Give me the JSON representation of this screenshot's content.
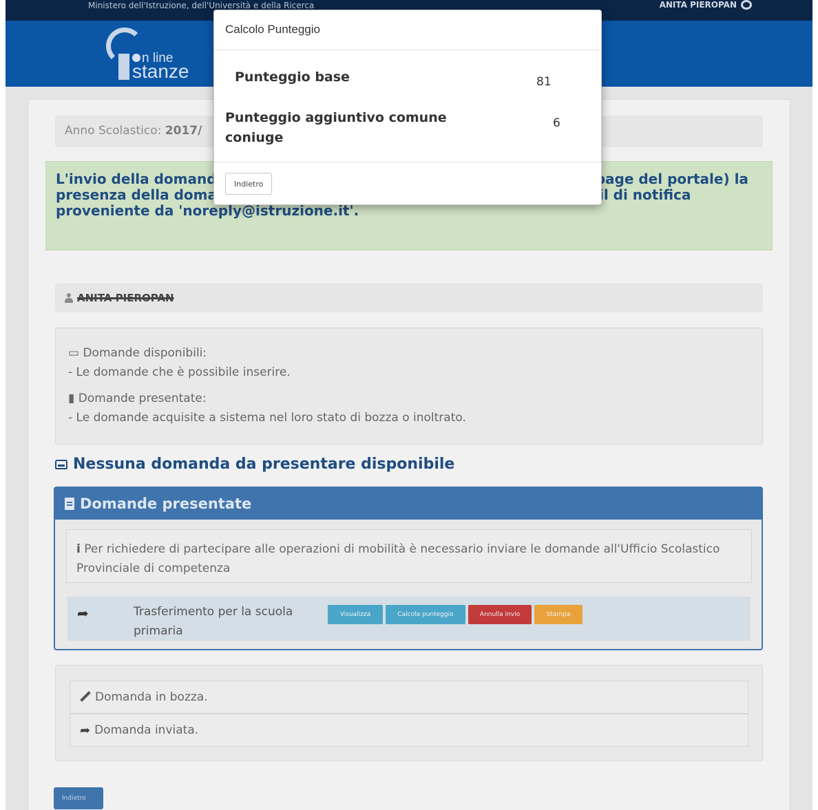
{
  "header": {
    "ministry_text": "Ministero dell'Istruzione, dell'Università e della Ricerca",
    "user_name_top": "ANITA PIEROPAN",
    "logo_small": "n line",
    "logo_big": "stanze"
  },
  "page": {
    "year_label": "Anno Scolastico:",
    "year_value": "2017/",
    "notice_text": "L'invio della domanda [...] Ufficio Scolastico Provinciale di compe[...] page del portale) la presenza della domanda e nella casella di posta la ricezione dell'e-mail di notifica proveniente da 'noreply@istruzione.it'.",
    "user_row_name": "ANITA PIEROPAN",
    "legend": {
      "available_title": "Domande disponibili:",
      "available_desc": "- Le domande che è possibile inserire.",
      "presented_title": "Domande presentate:",
      "presented_desc": "- Le domande acquisite a sistema nel loro stato di bozza o inoltrato."
    },
    "no_available_title": "Nessuna domanda da presentare disponibile",
    "panel": {
      "title": "Domande presentate",
      "info_text": "Per richiedere di partecipare alle operazioni di mobilità è necessario inviare le domande all'Ufficio Scolastico Provinciale di competenza",
      "row_label": "Trasferimento per la scuola primaria",
      "buttons": {
        "view": "Visualizza",
        "calc": "Calcola punteggio",
        "annulla": "Annulla invio",
        "stampa": "Stampa"
      }
    },
    "status": {
      "draft": "Domanda in bozza.",
      "sent": "Domanda inviata."
    },
    "back_button": "Indietro"
  },
  "modal": {
    "title": "Calcolo Punteggio",
    "base_label": "Punteggio base",
    "base_value": "81",
    "extra_label": "Punteggio aggiuntivo comune coniuge",
    "extra_value": "6",
    "back_button": "Indietro"
  },
  "colors": {
    "header_blue": "#0c56a6",
    "panel_blue": "#3f74ad",
    "notice_green": "#d0e2c4",
    "btn_info": "#4aa6c8",
    "btn_danger": "#c23a3a",
    "btn_warning": "#e8a23a"
  }
}
